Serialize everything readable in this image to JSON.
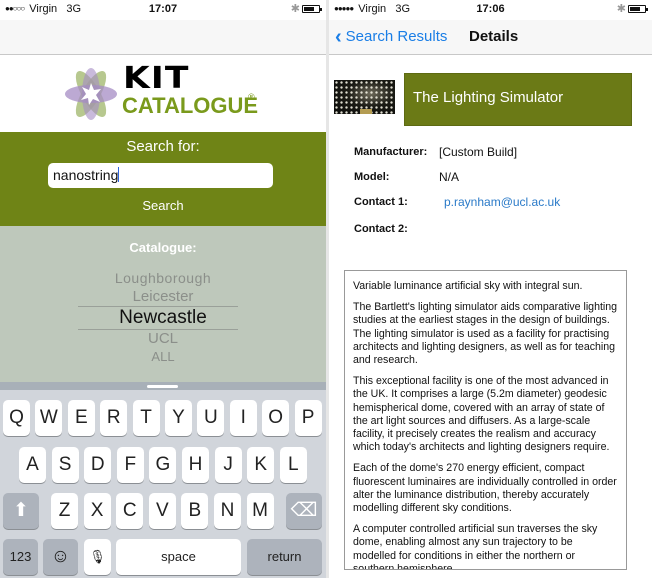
{
  "left_screen": {
    "status_bar": {
      "signal": "●●○○○",
      "carrier": "Virgin",
      "network": "3G",
      "time": "17:07"
    },
    "logo": {
      "line1": "KIT",
      "line2": "CATALOGUE",
      "registered": "®"
    },
    "search": {
      "label": "Search for:",
      "input_value": "nanostring",
      "button_label": "Search"
    },
    "catalogue": {
      "label": "Catalogue:",
      "options": [
        "Loughborough",
        "Leicester",
        "Newcastle",
        "UCL",
        "ALL"
      ],
      "selected": "Newcastle"
    },
    "keyboard": {
      "row1": [
        "Q",
        "W",
        "E",
        "R",
        "T",
        "Y",
        "U",
        "I",
        "O",
        "P"
      ],
      "row2": [
        "A",
        "S",
        "D",
        "F",
        "G",
        "H",
        "J",
        "K",
        "L"
      ],
      "row3": [
        "Z",
        "X",
        "C",
        "V",
        "B",
        "N",
        "M"
      ],
      "numbers_label": "123",
      "space_label": "space",
      "return_label": "return",
      "shift_icon": "⬆",
      "delete_icon": "⌫",
      "emoji_icon": "☺",
      "mic_icon": "🎙"
    }
  },
  "right_screen": {
    "status_bar": {
      "signal": "●●●●●",
      "carrier": "Virgin",
      "network": "3G",
      "time": "17:06"
    },
    "nav": {
      "back_label": "Search Results",
      "title": "Details"
    },
    "item_title": "The Lighting Simulator",
    "fields": [
      {
        "label": "Manufacturer:",
        "value": "[Custom Build]"
      },
      {
        "label": "Model:",
        "value": "N/A"
      },
      {
        "label": "Contact 1:",
        "value": "p.raynham@ucl.ac.uk"
      },
      {
        "label": "Contact 2:",
        "value": ""
      }
    ],
    "description": [
      "Variable luminance artificial sky with integral sun.",
      "The Bartlett's lighting simulator aids comparative lighting studies at the earliest stages in the design of buildings. The lighting simulator is used as a facility for practising architects and lighting designers, as well as for teaching and research.",
      "This exceptional facility is one of the most advanced in the UK. It comprises a large (5.2m diameter) geodesic hemispherical dome, covered with an array of state of the art light sources and diffusers. As a large-scale facility, it precisely creates the realism and accuracy which today's architects and lighting designers require.",
      "Each of the dome's 270 energy efficient, compact fluorescent luminaires are individually controlled in order alter the luminance distribution, thereby accurately modelling different sky conditions.",
      "A computer controlled artificial sun traverses the sky dome, enabling almost any sun trajectory to be modelled for conditions in either the northern or southern hemisphere."
    ]
  },
  "colors": {
    "brand_green": "#6f8416",
    "logo_green": "#7a9a1c",
    "link_blue": "#1a7ee6",
    "picker_bg": "#bec8bb"
  }
}
